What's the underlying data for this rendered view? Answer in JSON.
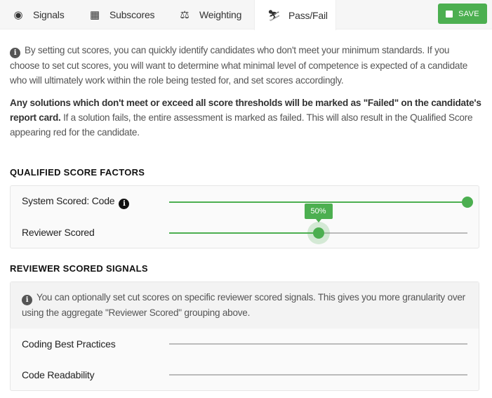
{
  "tabs": [
    {
      "label": "Signals",
      "icon": "signal-icon"
    },
    {
      "label": "Subscores",
      "icon": "abacus-icon"
    },
    {
      "label": "Weighting",
      "icon": "scale-icon"
    },
    {
      "label": "Pass/Fail",
      "icon": "pass-fail-icon",
      "active": true
    }
  ],
  "save_label": "SAVE",
  "intro": {
    "text": "By setting cut scores, you can quickly identify candidates who don't meet your minimum standards. If you choose to set cut scores, you will want to determine what minimal level of competence is expected of a candidate who will ultimately work within the role being tested for, and set scores accordingly.",
    "bold": "Any solutions which don't meet or exceed all score thresholds will be marked as \"Failed\" on the candidate's report card.",
    "rest": " If a solution fails, the entire assessment is marked as failed. This will also result in the Qualified Score appearing red for the candidate."
  },
  "qualified": {
    "heading": "QUALIFIED SCORE FACTORS",
    "rows": [
      {
        "label": "System Scored: Code",
        "value_pct": 100
      },
      {
        "label": "Reviewer Scored",
        "value_pct": 50,
        "tooltip": "50%"
      }
    ]
  },
  "reviewer": {
    "heading": "REVIEWER SCORED SIGNALS",
    "info": "You can optionally set cut scores on specific reviewer scored signals. This gives you more granularity over using the aggregate \"Reviewer Scored\" grouping above.",
    "rows": [
      {
        "label": "Coding Best Practices"
      },
      {
        "label": "Code Readability"
      }
    ]
  },
  "colors": {
    "accent": "#4caf50",
    "track": "#bbbbbb"
  }
}
